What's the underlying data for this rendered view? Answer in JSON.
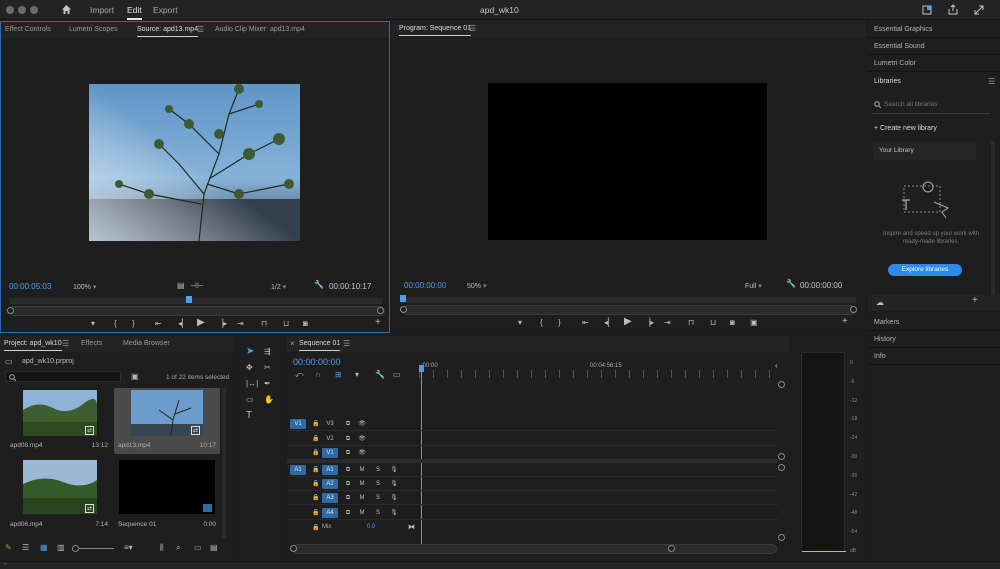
{
  "window": {
    "title": "apd_wk10"
  },
  "nav": {
    "import": "Import",
    "edit": "Edit",
    "export": "Export"
  },
  "source": {
    "tabs": [
      "Effect Controls",
      "Lumetri Scopes",
      "Source: apd13.mp4",
      "Audio Clip Mixer: apd13.mp4"
    ],
    "timecode": "00:00:05:03",
    "zoom": "100%",
    "resolution": "1/2",
    "duration": "00:00:10:17",
    "playhead": 0.48
  },
  "program": {
    "tab": "Program: Sequence 01",
    "timecode": "00:00:00:00",
    "zoom": "50%",
    "resolution": "Full",
    "duration": "00:00:00:00"
  },
  "right": {
    "essential_graphics": "Essential Graphics",
    "essential_sound": "Essential Sound",
    "lumetri_color": "Lumetri Color",
    "libraries": "Libraries",
    "search_placeholder": "Search all libraries",
    "create_library": "Create new library",
    "your_library": "Your Library",
    "promo": "Inspire and speed up your work with ready-made libraries.",
    "explore": "Explore libraries",
    "markers": "Markers",
    "history": "History",
    "info": "Info"
  },
  "project": {
    "tabs": [
      "Project: apd_wk10",
      "Effects",
      "Media Browser"
    ],
    "file": "apd_wk10.prproj",
    "selection": "1 of 22 items selected",
    "items": [
      {
        "name": "apd08.mp4",
        "duration": "13:12"
      },
      {
        "name": "apd13.mp4",
        "duration": "10:17"
      },
      {
        "name": "apd06.mp4",
        "duration": "7:14"
      },
      {
        "name": "Sequence 01",
        "duration": "0:00"
      }
    ]
  },
  "timeline": {
    "tab": "Sequence 01",
    "timecode": "00:00:00:00",
    "ruler_start": ":00:00",
    "ruler_mid": "00:04:56:15",
    "video_tracks": [
      "V3",
      "V2",
      "V1"
    ],
    "audio_tracks": [
      "A1",
      "A2",
      "A3",
      "A4"
    ],
    "source_v": "V1",
    "source_a": "A1",
    "mix_label": "Mix",
    "mix_value": "0.0",
    "m": "M",
    "s": "S"
  },
  "meter": {
    "labels": [
      "0",
      "-6",
      "-12",
      "-18",
      "-24",
      "-30",
      "-36",
      "-42",
      "-48",
      "-54",
      "dB"
    ]
  },
  "colors": {
    "accent": "#2d8ceb",
    "timecode": "#4f9fea",
    "selection": "#2d6aa6"
  }
}
